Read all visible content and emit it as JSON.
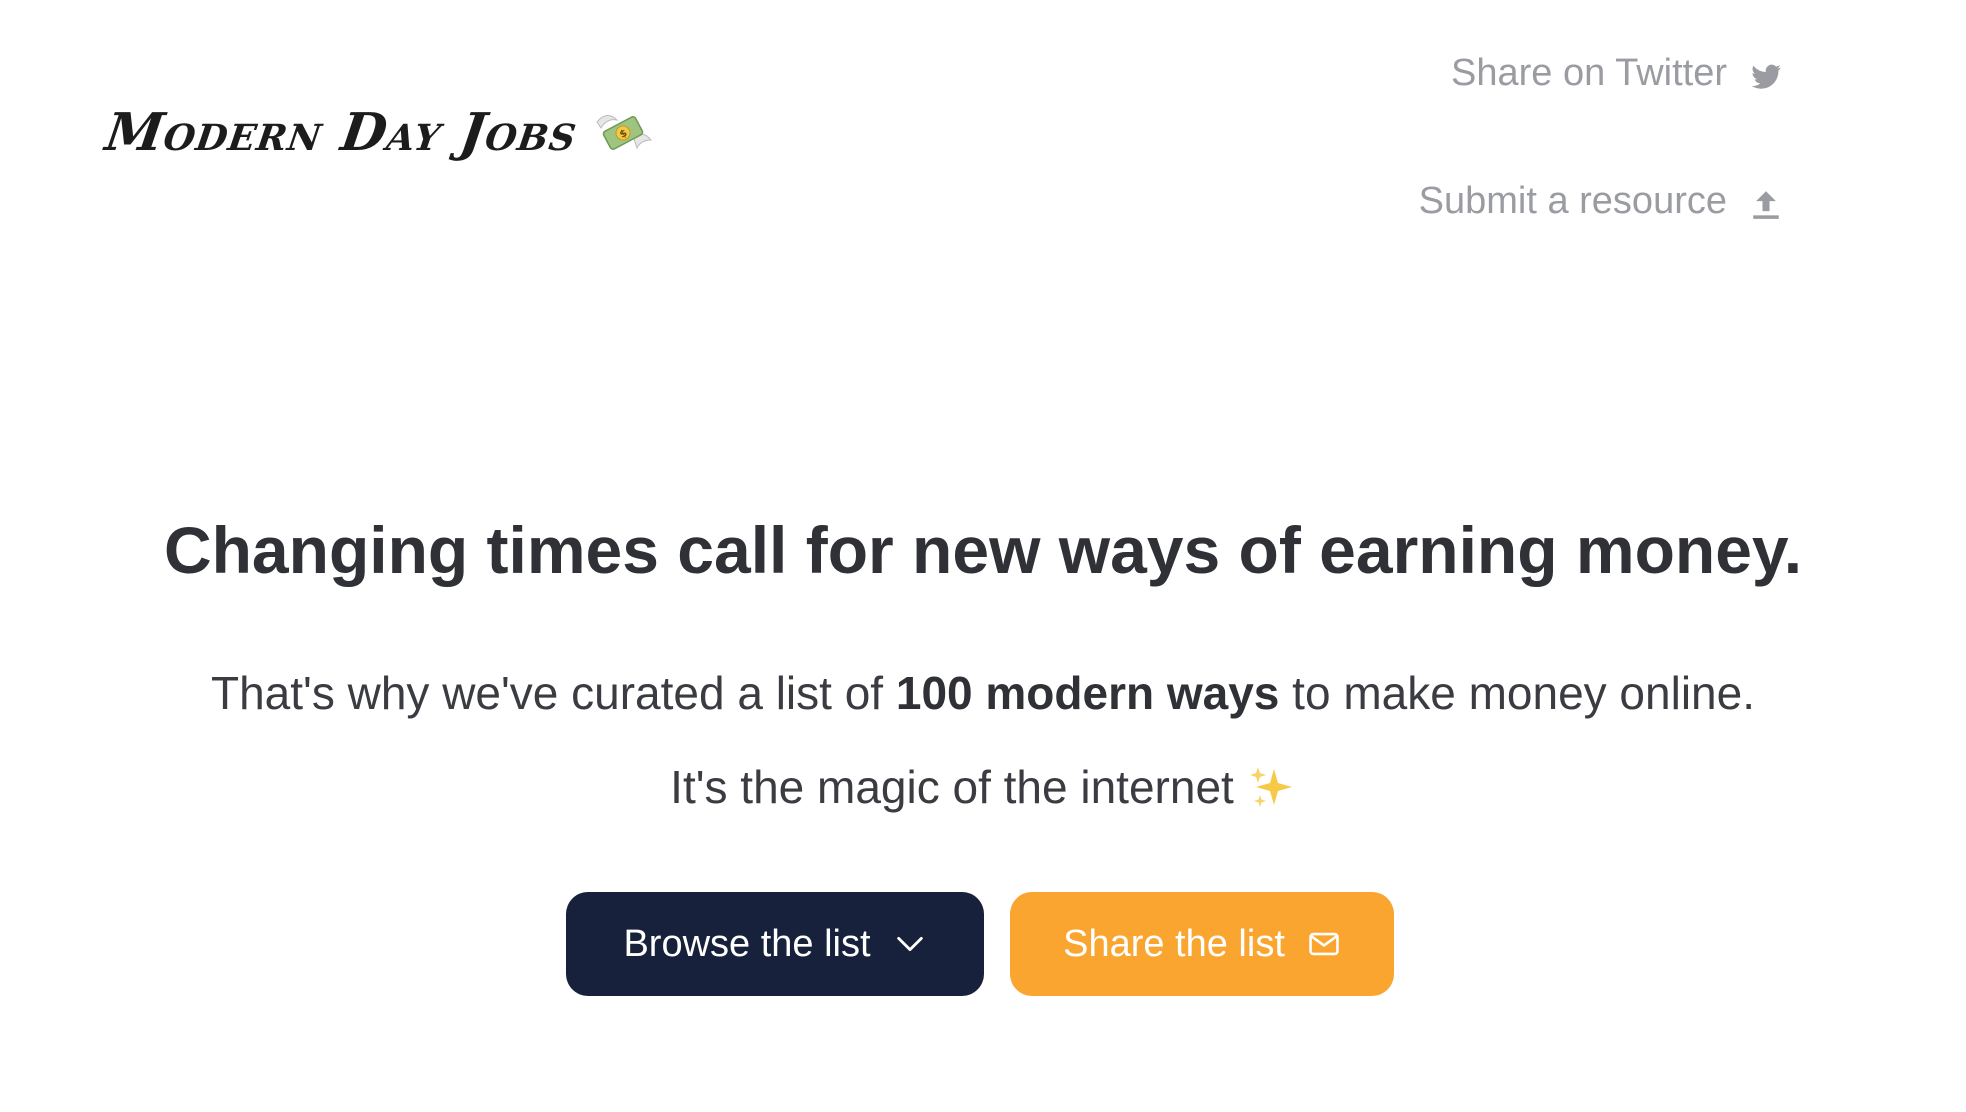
{
  "logo": {
    "text": "Modern Day Jobs",
    "icon": "money-with-wings-icon"
  },
  "nav": {
    "twitter_label": "Share on Twitter",
    "twitter_icon": "twitter-icon",
    "submit_label": "Submit a resource",
    "submit_icon": "upload-icon"
  },
  "hero": {
    "headline": "Changing times call for new ways of earning money.",
    "subline_before": "That's why we've curated a list of ",
    "subline_bold": "100 modern ways",
    "subline_after": " to make money online.",
    "magic_text": "It's the magic of the internet",
    "magic_icon": "sparkles-icon"
  },
  "buttons": {
    "browse_label": "Browse the list",
    "browse_icon": "chevron-down-icon",
    "share_label": "Share the list",
    "share_icon": "envelope-icon"
  },
  "colors": {
    "browse_bg": "#17213b",
    "share_bg": "#f9a530",
    "nav_text": "#9a9ca2",
    "headline": "#2f3136"
  }
}
